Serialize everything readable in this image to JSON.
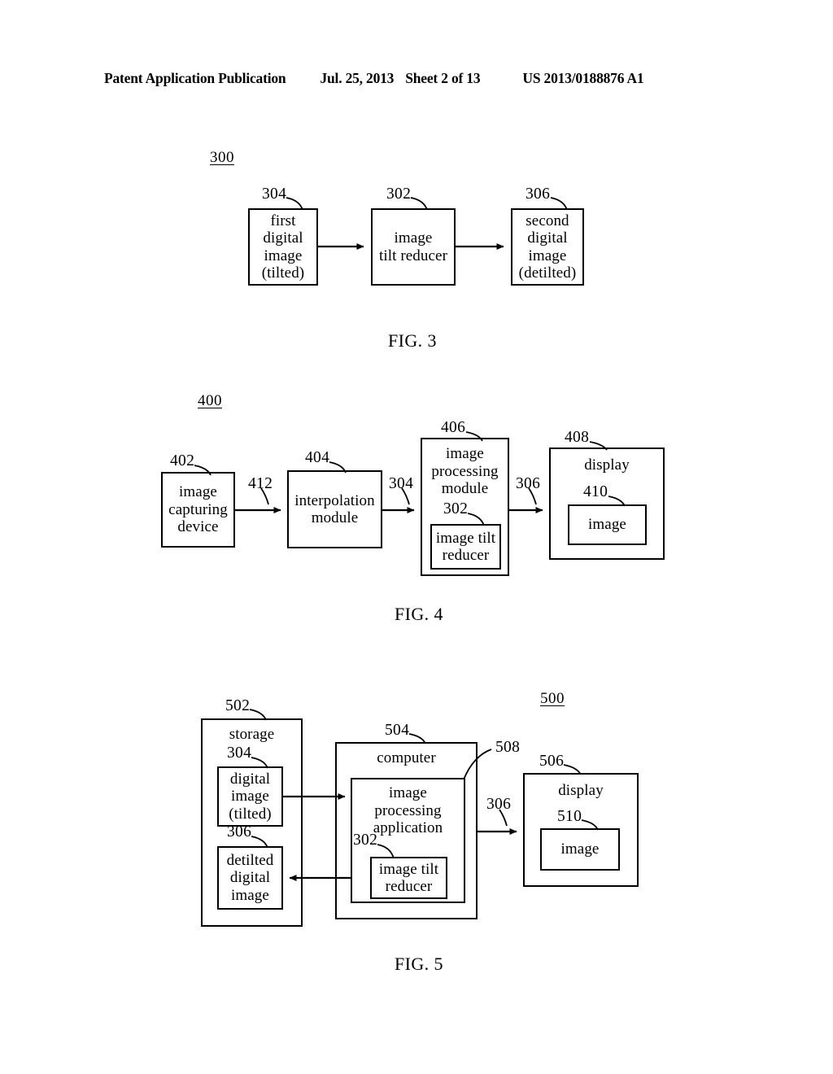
{
  "header": {
    "publication": "Patent Application Publication",
    "date": "Jul. 25, 2013",
    "sheet": "Sheet 2 of 13",
    "patent_number": "US 2013/0188876 A1"
  },
  "figures": [
    {
      "id": "fig3",
      "caption": "FIG. 3",
      "system_label": "300",
      "boxes": [
        {
          "ref": "304",
          "text": "first\ndigital\nimage\n(tilted)"
        },
        {
          "ref": "302",
          "text": "image\ntilt reducer"
        },
        {
          "ref": "306",
          "text": "second\ndigital\nimage\n(detilted)"
        }
      ]
    },
    {
      "id": "fig4",
      "caption": "FIG. 4",
      "system_label": "400",
      "boxes": [
        {
          "ref": "402",
          "text": "image\ncapturing\ndevice"
        },
        {
          "ref": "404",
          "text": "interpolation\nmodule"
        },
        {
          "ref": "406",
          "text": "image\nprocessing\nmodule"
        },
        {
          "ref": "302",
          "text": "image tilt\nreducer"
        },
        {
          "ref": "408",
          "text": "display"
        },
        {
          "ref": "410",
          "text": "image"
        }
      ],
      "arrow_labels": [
        {
          "ref": "412"
        },
        {
          "ref": "304"
        },
        {
          "ref": "306"
        }
      ]
    },
    {
      "id": "fig5",
      "caption": "FIG. 5",
      "system_label": "500",
      "boxes": [
        {
          "ref": "502",
          "text": "storage"
        },
        {
          "ref": "304",
          "text": "digital\nimage\n(tilted)"
        },
        {
          "ref": "306",
          "text": "detilted\ndigital\nimage"
        },
        {
          "ref": "504",
          "text": "computer"
        },
        {
          "ref": "508",
          "text": "image\nprocessing\napplication"
        },
        {
          "ref": "302",
          "text": "image tilt\nreducer"
        },
        {
          "ref": "506",
          "text": "display"
        },
        {
          "ref": "510",
          "text": "image"
        }
      ],
      "arrow_labels": [
        {
          "ref": "306"
        }
      ]
    }
  ],
  "fig3": {
    "system_label": "300",
    "caption": "FIG. 3",
    "box_304_ref": "304",
    "box_304_text": "first\ndigital\nimage\n(tilted)",
    "box_302_ref": "302",
    "box_302_text": "image\ntilt reducer",
    "box_306_ref": "306",
    "box_306_text": "second\ndigital\nimage\n(detilted)"
  },
  "fig4": {
    "system_label": "400",
    "caption": "FIG. 4",
    "box_402_ref": "402",
    "box_402_text": "image\ncapturing\ndevice",
    "arrow_412_ref": "412",
    "box_404_ref": "404",
    "box_404_text": "interpolation\nmodule",
    "arrow_304_ref": "304",
    "box_406_ref": "406",
    "box_406_text": "image\nprocessing\nmodule",
    "box_302_ref": "302",
    "box_302_text": "image tilt\nreducer",
    "arrow_306_ref": "306",
    "box_408_ref": "408",
    "box_408_text": "display",
    "box_410_ref": "410",
    "box_410_text": "image"
  },
  "fig5": {
    "system_label": "500",
    "caption": "FIG. 5",
    "box_502_ref": "502",
    "box_502_text": "storage",
    "box_304_ref": "304",
    "box_304_text": "digital\nimage\n(tilted)",
    "box_306_ref": "306",
    "box_306_text": "detilted\ndigital\nimage",
    "box_504_ref": "504",
    "box_504_text": "computer",
    "box_508_ref": "508",
    "box_508_text": "image\nprocessing\napplication",
    "box_302_ref": "302",
    "box_302_text": "image tilt\nreducer",
    "arrow_306_ref": "306",
    "box_506_ref": "506",
    "box_506_text": "display",
    "box_510_ref": "510",
    "box_510_text": "image"
  }
}
